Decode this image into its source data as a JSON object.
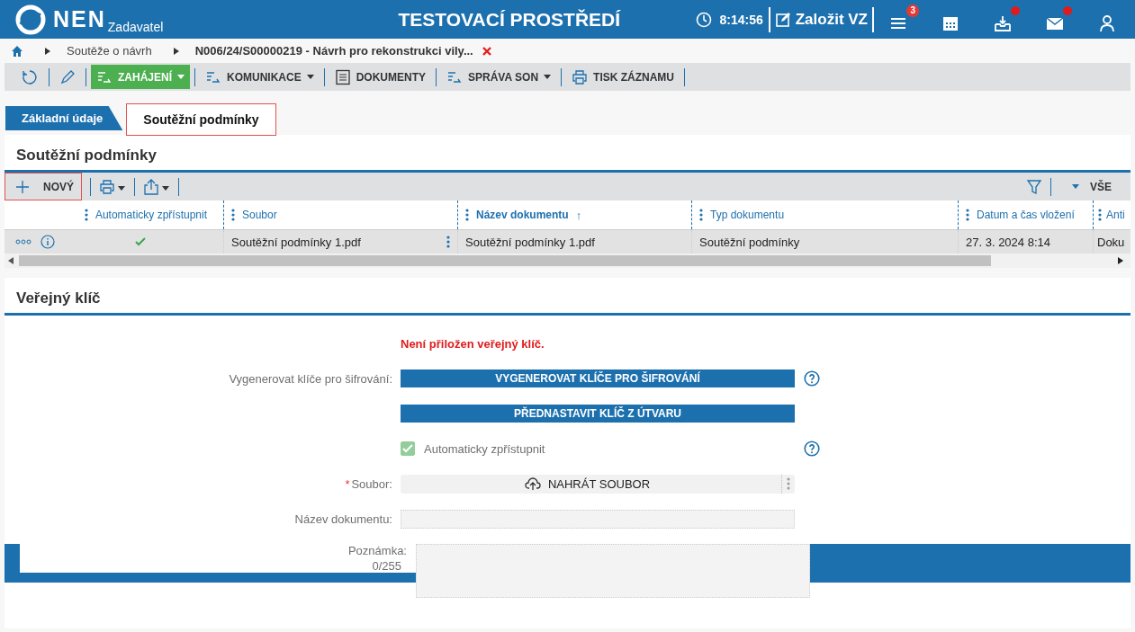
{
  "header": {
    "logo": "NEN",
    "subtitle": "Zadavatel",
    "environment": "TESTOVACÍ PROSTŘEDÍ",
    "time": "8:14:56",
    "create_button": "Založit VZ",
    "icons": [
      {
        "kind": "menu",
        "badge": "3",
        "dot": false
      },
      {
        "kind": "calendar",
        "dot": false
      },
      {
        "kind": "inbox",
        "dot": true
      },
      {
        "kind": "mail",
        "dot": true
      },
      {
        "kind": "user",
        "dot": false
      }
    ]
  },
  "breadcrumb": [
    "Soutěže o návrh",
    "N006/24/S00000219 - Návrh pro rekonstrukci vily..."
  ],
  "toolbar": [
    {
      "kind": "refresh"
    },
    {
      "kind": "edit"
    },
    {
      "kind": "flow",
      "label": "ZAHÁJENÍ",
      "primary": true,
      "dropdown": true
    },
    {
      "kind": "flow",
      "label": "KOMUNIKACE",
      "primary": false,
      "dropdown": true
    },
    {
      "kind": "document",
      "label": "DOKUMENTY",
      "primary": false,
      "dropdown": false
    },
    {
      "kind": "flow",
      "label": "SPRÁVA SON",
      "primary": false,
      "dropdown": true
    },
    {
      "kind": "print",
      "label": "TISK ZÁZNAMU",
      "primary": false,
      "dropdown": false
    }
  ],
  "tabs": [
    {
      "label": "Základní údaje",
      "selected": false
    },
    {
      "label": "Soutěžní podmínky",
      "selected": true
    }
  ],
  "conditions_panel": {
    "title": "Soutěžní podmínky",
    "new_button": "NOVÝ",
    "filter_label": "VŠE",
    "columns": [
      {
        "label": "Automaticky zpřístupnit"
      },
      {
        "label": "Soubor"
      },
      {
        "label": "Název dokumentu",
        "sort": "↑"
      },
      {
        "label": "Typ dokumentu"
      },
      {
        "label": "Datum a čas vložení"
      },
      {
        "label": "Anti"
      }
    ],
    "rows": [
      {
        "auto_publish": true,
        "file": "Soutěžní podmínky 1.pdf",
        "document_name": "Soutěžní podmínky 1.pdf",
        "document_type": "Soutěžní podmínky",
        "inserted": "27. 3. 2024 8:14",
        "column_6": "Doku"
      }
    ]
  },
  "key_panel": {
    "title": "Veřejný klíč",
    "error": "Není přiložen veřejný klíč.",
    "generate_label": "Vygenerovat klíče pro šifrování:",
    "generate_button": "VYGENEROVAT KLÍČE PRO ŠIFROVÁNÍ",
    "preset_button": "PŘEDNASTAVIT KLÍČ Z ÚTVARU",
    "auto_publish": {
      "label": "Automaticky zpřístupnit",
      "checked": true,
      "disabled": true
    },
    "file_label": "Soubor:",
    "required_mark": "*",
    "upload_button": "NAHRÁT SOUBOR",
    "name_label": "Název dokumentu:",
    "note_label": "Poznámka:",
    "note_counter": "0/255"
  }
}
